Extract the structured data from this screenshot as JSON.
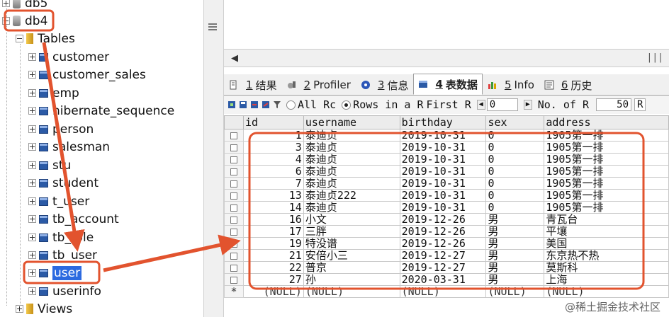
{
  "tree": {
    "db_partial": "db5",
    "db_selected": "db4",
    "tables_folder": "Tables",
    "tables": [
      "customer",
      "customer_sales",
      "emp",
      "hibernate_sequence",
      "person",
      "salesman",
      "stu",
      "student",
      "t_user",
      "tb_account",
      "tb_role",
      "tb_user",
      "user",
      "userinfo"
    ],
    "selected_table": "user",
    "views_folder": "Views"
  },
  "tabs": [
    {
      "num": "1",
      "label": "结果",
      "icon": "result-icon"
    },
    {
      "num": "2",
      "label": "Profiler",
      "icon": "profiler-icon"
    },
    {
      "num": "3",
      "label": "信息",
      "icon": "info-icon"
    },
    {
      "num": "4",
      "label": "表数据",
      "icon": "table-data-icon",
      "active": true
    },
    {
      "num": "5",
      "label": "Info",
      "icon": "info-chart-icon"
    },
    {
      "num": "6",
      "label": "历史",
      "icon": "history-icon"
    }
  ],
  "toolbar": {
    "all_rows_label": "All Rc",
    "rows_in_range_label": "Rows in a R",
    "first_label": "First R",
    "first_value": "0",
    "no_of_label": "No. of R",
    "count_value": "50",
    "end_label": "R"
  },
  "grid": {
    "columns": [
      "id",
      "username",
      "birthday",
      "sex",
      "address"
    ],
    "rows": [
      [
        "1",
        "泰迪贞",
        "2019-10-31",
        "0",
        "1905第一排"
      ],
      [
        "3",
        "泰迪贞",
        "2019-10-31",
        "0",
        "1905第一排"
      ],
      [
        "4",
        "泰迪贞",
        "2019-10-31",
        "0",
        "1905第一排"
      ],
      [
        "6",
        "泰迪贞",
        "2019-10-31",
        "0",
        "1905第一排"
      ],
      [
        "7",
        "泰迪贞",
        "2019-10-31",
        "0",
        "1905第一排"
      ],
      [
        "13",
        "泰迪贞222",
        "2019-10-31",
        "0",
        "1905第一排"
      ],
      [
        "14",
        "泰迪贞",
        "2019-10-31",
        "0",
        "1905第一排"
      ],
      [
        "16",
        "小文",
        "2019-12-26",
        "男",
        "青瓦台"
      ],
      [
        "17",
        "三胖",
        "2019-12-26",
        "男",
        "平壤"
      ],
      [
        "19",
        "特没谱",
        "2019-12-26",
        "男",
        "美国"
      ],
      [
        "21",
        "安倍小三",
        "2019-12-27",
        "男",
        "东京热不热"
      ],
      [
        "22",
        "普京",
        "2019-12-27",
        "男",
        "莫斯科"
      ],
      [
        "27",
        "孙",
        "2020-03-31",
        "男",
        "上海"
      ]
    ],
    "new_row_marker": "*",
    "null_text": "(NULL)"
  },
  "watermark": "@稀土掘金技术社区",
  "colors": {
    "highlight": "#e2532e",
    "selection": "#2c6ae0"
  }
}
